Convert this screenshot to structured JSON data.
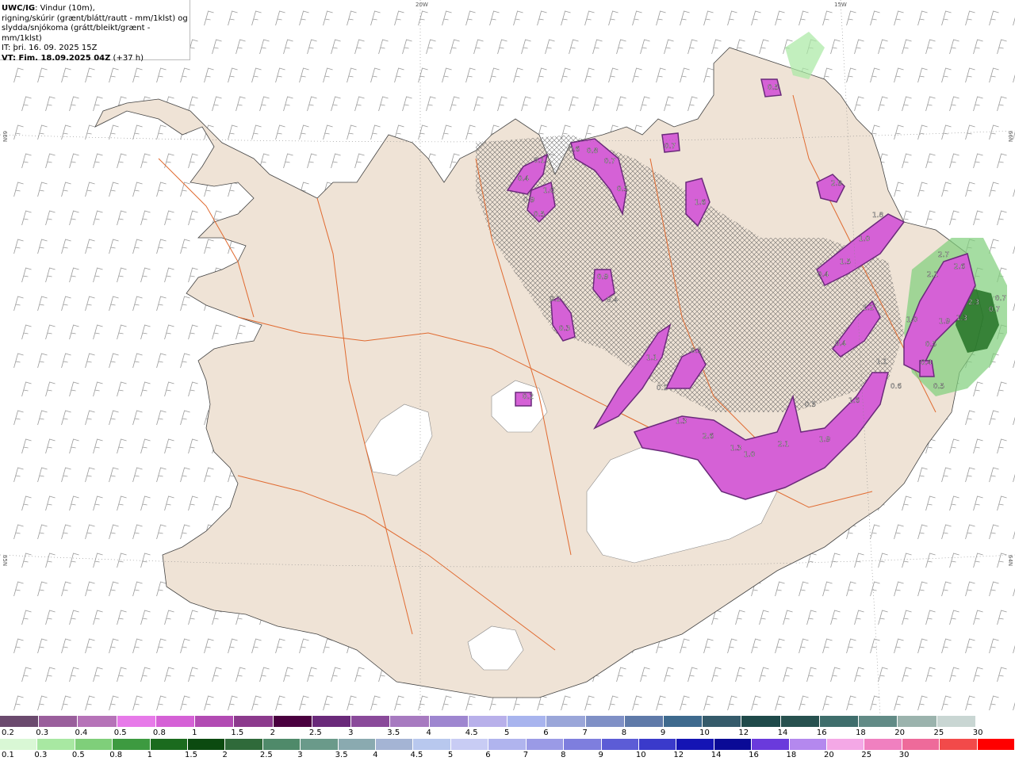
{
  "info": {
    "model": "UWC/IG",
    "title_rest": ": Vindur (10m),",
    "line2": "rigning/skúrir (grænt/blátt/rautt - mm/1klst) og",
    "line3": "slydda/snjókoma (grátt/bleikt/grænt - mm/1klst)",
    "line4": "IT: þri. 16. 09. 2025 15Z",
    "valid_label": "VT: Fim. 18.09.2025 04Z",
    "valid_offset": " (+37 h)"
  },
  "grid_labels": {
    "top_left": "20W",
    "top_right": "15W",
    "left_upper": "66N",
    "left_lower": "65N",
    "right_upper": "66N",
    "right_lower": "64N"
  },
  "legend_snow": {
    "colors": [
      "#6b4a6e",
      "#9a5f9c",
      "#b673b8",
      "#e77ae9",
      "#d561d6",
      "#b24bb3",
      "#8c3a8d",
      "#4a003f",
      "#6a2a7a",
      "#8a4a9a",
      "#a77ac0",
      "#9e86d0",
      "#b8b0ea",
      "#a8b4ee",
      "#9aa6d9",
      "#7f90c6",
      "#5f7aa9",
      "#3e6a8e",
      "#355b6b",
      "#1f4a4a",
      "#27514f",
      "#3f6e6c",
      "#628b86",
      "#9bb3ad",
      "#c9d6d3",
      "#ffffff"
    ],
    "labels": [
      "0.2",
      "0.3",
      "0.4",
      "0.5",
      "0.8",
      "1",
      "1.5",
      "2",
      "2.5",
      "3",
      "3.5",
      "4",
      "4.5",
      "5",
      "6",
      "7",
      "8",
      "9",
      "10",
      "12",
      "14",
      "16",
      "18",
      "20",
      "25",
      "30"
    ]
  },
  "legend_rain": {
    "colors": [
      "#d9f7d5",
      "#a8e8a2",
      "#7fcf7a",
      "#3d9a40",
      "#1b6b1e",
      "#0b4a10",
      "#2f6a3a",
      "#4f8a6a",
      "#6a9a8a",
      "#8aaab0",
      "#a4b4d4",
      "#b8c8ee",
      "#c8ccf4",
      "#b0b4ee",
      "#9a9ae6",
      "#7e7ede",
      "#5c5cd6",
      "#3a3acb",
      "#1414b4",
      "#0a0a96",
      "#6a3adc",
      "#b488ee",
      "#f4a8e6",
      "#f080c0",
      "#ee6a9a",
      "#f24a4a",
      "#ff0000"
    ],
    "labels": [
      "0.1",
      "0.3",
      "0.5",
      "0.8",
      "1",
      "1.5",
      "2",
      "2.5",
      "3",
      "3.5",
      "4",
      "4.5",
      "5",
      "6",
      "7",
      "8",
      "9",
      "10",
      "12",
      "14",
      "16",
      "18",
      "20",
      "25",
      "30"
    ]
  },
  "precip_labels": [
    "0.5",
    "0.1",
    "0.4",
    "1.0",
    "0.9",
    "0.5",
    "0.6",
    "0.8",
    "0.7",
    "0.5",
    "0.7",
    "1.6",
    "2.9",
    "1.8",
    "1.0",
    "1.5",
    "0.4",
    "0.2",
    "0.4",
    "0.3",
    "0.9",
    "1.1",
    "0.5",
    "0.2",
    "0.5",
    "1.2",
    "0.4",
    "2.7",
    "2.6",
    "2.1",
    "2.3",
    "1.9",
    "1.3",
    "0.7",
    "0.7",
    "1.0",
    "0.5",
    "0.4",
    "0.5",
    "1.1",
    "0.6",
    "1.6",
    "1.3",
    "2.6",
    "1.3",
    "1.0",
    "2.1",
    "1.9",
    "0.2"
  ]
}
